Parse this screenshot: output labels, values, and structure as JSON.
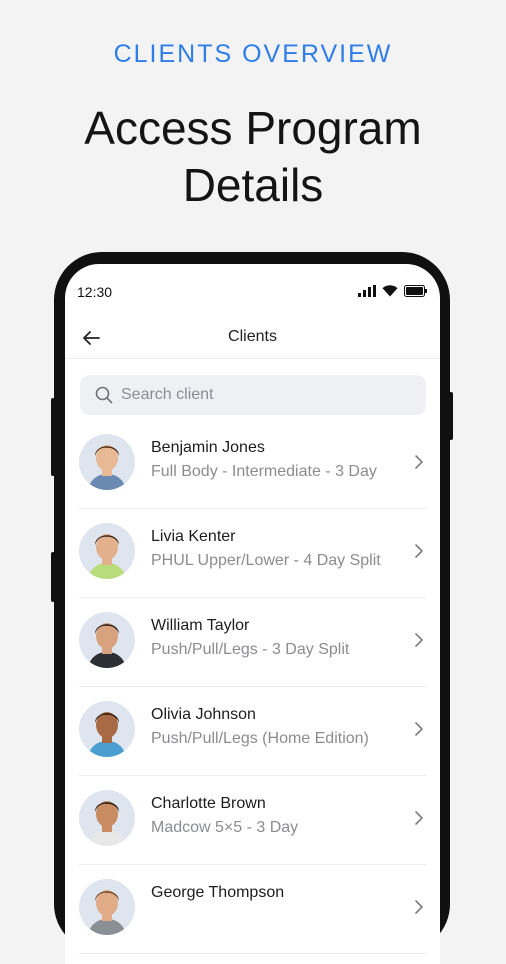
{
  "eyebrow": "CLIENTS OVERVIEW",
  "headline": [
    "Access Program",
    "Details"
  ],
  "status_bar": {
    "time": "12:30"
  },
  "app_bar": {
    "title": "Clients"
  },
  "search": {
    "placeholder": "Search client"
  },
  "clients": [
    {
      "name": "Benjamin Jones",
      "program": "Full Body - Intermediate - 3 Day",
      "skin": "#e7b994",
      "hair": "#4a2d1a",
      "shirt": "#6a8ab2"
    },
    {
      "name": "Livia Kenter",
      "program": "PHUL Upper/Lower - 4 Day Split",
      "skin": "#e2b08c",
      "hair": "#3d2718",
      "shirt": "#b8dc7a"
    },
    {
      "name": "William Taylor",
      "program": "Push/Pull/Legs - 3 Day Split",
      "skin": "#d9a27e",
      "hair": "#2a1d16",
      "shirt": "#2d2f35"
    },
    {
      "name": "Olivia Johnson",
      "program": "Push/Pull/Legs (Home Edition)",
      "skin": "#a86a45",
      "hair": "#2b1a10",
      "shirt": "#4b9fd0"
    },
    {
      "name": "Charlotte Brown",
      "program": "Madcow 5×5 - 3 Day",
      "skin": "#c98b62",
      "hair": "#1f1612",
      "shirt": "#e8e8e8"
    },
    {
      "name": "George Thompson",
      "program": "",
      "skin": "#e0ab86",
      "hair": "#6b4a2e",
      "shirt": "#8a8f96"
    }
  ],
  "colors": {
    "accent": "#2f7ee8",
    "background": "#f3f3f4",
    "phone_frame": "#101010"
  }
}
